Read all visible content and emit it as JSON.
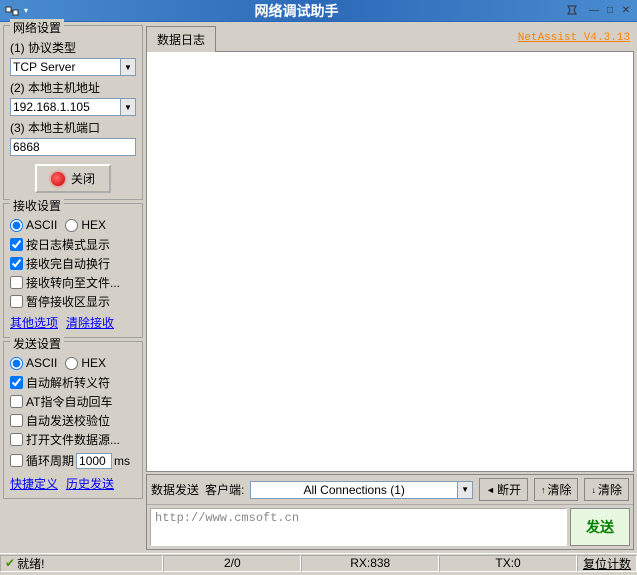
{
  "title": "网络调试助手",
  "version": "NetAssist V4.3.13",
  "network_settings": {
    "title": "网络设置",
    "protocol_label": "(1) 协议类型",
    "protocol_value": "TCP Server",
    "host_label": "(2) 本地主机地址",
    "host_value": "192.168.1.105",
    "port_label": "(3) 本地主机端口",
    "port_value": "6868",
    "close_label": "关闭"
  },
  "recv_settings": {
    "title": "接收设置",
    "ascii": "ASCII",
    "hex": "HEX",
    "opt1": "按日志模式显示",
    "opt2": "接收完自动换行",
    "opt3": "接收转向至文件...",
    "opt4": "暂停接收区显示",
    "link1": "其他选项",
    "link2": "清除接收"
  },
  "send_settings": {
    "title": "发送设置",
    "ascii": "ASCII",
    "hex": "HEX",
    "opt1": "自动解析转义符",
    "opt2": "AT指令自动回车",
    "opt3": "自动发送校验位",
    "opt4": "打开文件数据源...",
    "cycle_label": "循环周期",
    "cycle_value": "1000",
    "cycle_unit": "ms",
    "link1": "快捷定义",
    "link2": "历史发送"
  },
  "tabs": {
    "log": "数据日志"
  },
  "send_panel": {
    "label": "数据发送",
    "client_label": "客户端:",
    "conn_value": "All Connections (1)",
    "disconnect": "断开",
    "clear": "清除",
    "clear2": "清除",
    "send": "发送",
    "input_value": "http://www.cmsoft.cn"
  },
  "status": {
    "ready": "就绪!",
    "counts": "2/0",
    "rx": "RX:838",
    "tx": "TX:0",
    "reset": "复位计数"
  }
}
